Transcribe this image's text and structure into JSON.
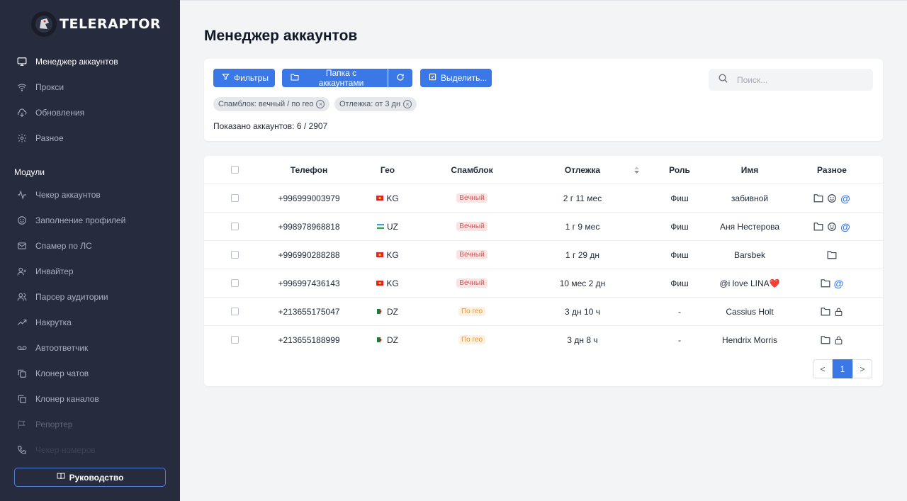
{
  "app": {
    "name": "TELERAPTOR"
  },
  "sidebar": {
    "items": [
      {
        "label": "Менеджер аккаунтов",
        "icon": "monitor-icon"
      },
      {
        "label": "Прокси",
        "icon": "wifi-icon"
      },
      {
        "label": "Обновления",
        "icon": "cloud-download-icon"
      },
      {
        "label": "Разное",
        "icon": "gear-icon"
      }
    ],
    "modules_label": "Модули",
    "modules": [
      {
        "label": "Чекер аккаунтов",
        "icon": "activity-icon"
      },
      {
        "label": "Заполнение профилей",
        "icon": "smile-icon"
      },
      {
        "label": "Спамер по ЛС",
        "icon": "mail-icon"
      },
      {
        "label": "Инвайтер",
        "icon": "user-plus-icon"
      },
      {
        "label": "Парсер аудитории",
        "icon": "users-icon"
      },
      {
        "label": "Накрутка",
        "icon": "trending-up-icon"
      },
      {
        "label": "Автоответчик",
        "icon": "voicemail-icon"
      },
      {
        "label": "Клонер чатов",
        "icon": "copy-icon"
      },
      {
        "label": "Клонер каналов",
        "icon": "copy-icon"
      },
      {
        "label": "Репортер",
        "icon": "flag-icon"
      },
      {
        "label": "Чекер номеров",
        "icon": "phone-icon"
      }
    ],
    "guide_label": "Руководство"
  },
  "main": {
    "title": "Менеджер аккаунтов",
    "toolbar": {
      "filters": "Фильтры",
      "folder": "Папка с аккаунтами",
      "select": "Выделить...",
      "search_placeholder": "Поиск..."
    },
    "chips": [
      "Спамблок: вечный / по гео",
      "Отлежка: от 3 дн"
    ],
    "count": "Показано аккаунтов: 6 / 2907",
    "table": {
      "headers": [
        "Телефон",
        "Гео",
        "Спамблок",
        "Отлежка",
        "Роль",
        "Имя",
        "Разное"
      ],
      "rows": [
        {
          "phone": "+996999003979",
          "geo": "KG",
          "spamblock": "Вечный",
          "spam_type": "red",
          "age": "2 г 11 мес",
          "role": "Фиш",
          "name": "забивной",
          "misc": [
            "folder-icon",
            "smile-icon",
            "at-icon"
          ]
        },
        {
          "phone": "+998978968818",
          "geo": "UZ",
          "spamblock": "Вечный",
          "spam_type": "red",
          "age": "1 г 9 мес",
          "role": "Фиш",
          "name": "Аня Нестерова",
          "misc": [
            "folder-icon",
            "smile-icon",
            "at-icon"
          ]
        },
        {
          "phone": "+996990288288",
          "geo": "KG",
          "spamblock": "Вечный",
          "spam_type": "red",
          "age": "1 г 29 дн",
          "role": "Фиш",
          "name": "Barsbek",
          "misc": [
            "folder-icon"
          ]
        },
        {
          "phone": "+996997436143",
          "geo": "KG",
          "spamblock": "Вечный",
          "spam_type": "red",
          "age": "10 мес 2 дн",
          "role": "Фиш",
          "name": "@i love LINA❤️",
          "misc": [
            "folder-icon",
            "at-icon"
          ]
        },
        {
          "phone": "+213655175047",
          "geo": "DZ",
          "spamblock": "По гео",
          "spam_type": "orange",
          "age": "3 дн 10 ч",
          "role": "-",
          "name": "Cassius Holt",
          "misc": [
            "folder-icon",
            "lock-icon"
          ]
        },
        {
          "phone": "+213655188999",
          "geo": "DZ",
          "spamblock": "По гео",
          "spam_type": "orange",
          "age": "3 дн 8 ч",
          "role": "-",
          "name": "Hendrix Morris",
          "misc": [
            "folder-icon",
            "lock-icon"
          ]
        }
      ]
    },
    "pagination": {
      "prev": "<",
      "current": "1",
      "next": ">"
    }
  },
  "colors": {
    "accent": "#3b78e7",
    "sidebar": "#262b3d",
    "badge_red": "#e05252",
    "badge_orange": "#e8943a"
  }
}
